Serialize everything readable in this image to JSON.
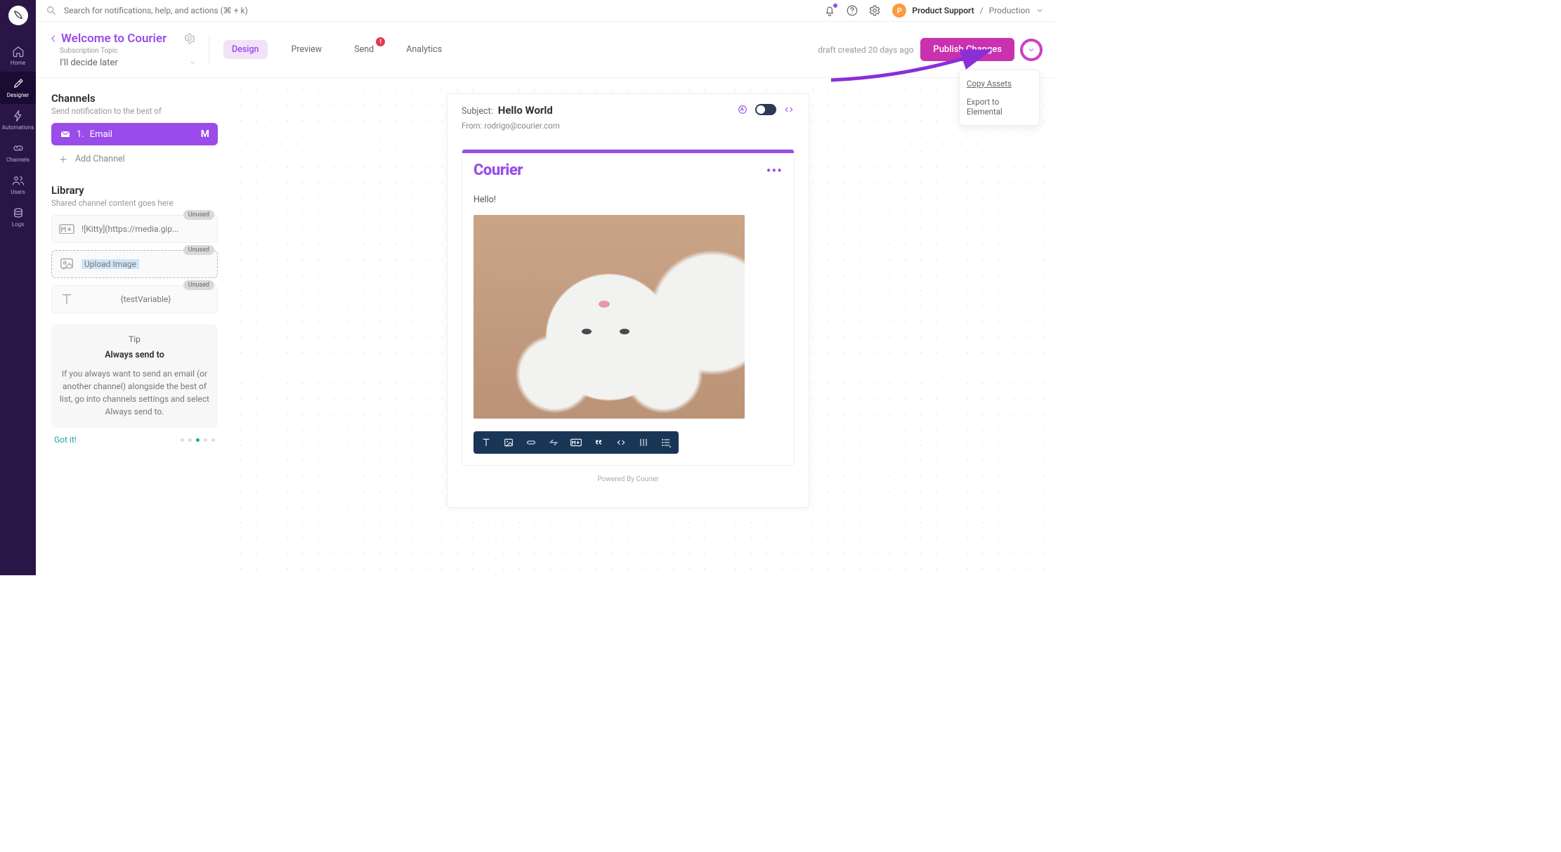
{
  "top": {
    "search_placeholder": "Search for notifications, help, and actions (⌘ + k)",
    "account_initial": "P",
    "account_name": "Product Support",
    "sep": "/",
    "env": "Production"
  },
  "rail": {
    "items": [
      {
        "label": "Home"
      },
      {
        "label": "Designer"
      },
      {
        "label": "Automations"
      },
      {
        "label": "Channels"
      },
      {
        "label": "Users"
      },
      {
        "label": "Logs"
      }
    ]
  },
  "header": {
    "title": "Welcome to Courier",
    "sub": "Subscription Topic",
    "select": "I'll decide later",
    "tabs": [
      "Design",
      "Preview",
      "Send",
      "Analytics"
    ],
    "send_badge": "!",
    "draft": "draft created 20 days ago",
    "publish": "Publish Changes",
    "menu": {
      "copy": "Copy Assets",
      "export": "Export to Elemental"
    }
  },
  "side": {
    "channels_h": "Channels",
    "channels_hint": "Send notification to the best of",
    "chan_num": "1.",
    "chan_label": "Email",
    "add": "Add Channel",
    "library_h": "Library",
    "library_hint": "Shared channel content goes here",
    "unused": "Unused",
    "lib1": "![Kitty](https://media.gip...",
    "lib2": "Upload Image",
    "lib3": "{testVariable}",
    "tip_label": "Tip",
    "tip_title": "Always send to",
    "tip_body": "If you always want to send an email (or another channel) alongside the best of list, go into channels settings and select Always send to.",
    "got": "Got it!"
  },
  "email": {
    "subject_label": "Subject:",
    "subject": "Hello World",
    "from_label": "From:",
    "from": "rodrigo@courier.com",
    "brand": "Courier",
    "hello": "Hello!",
    "footer": "Powered By Courier"
  }
}
